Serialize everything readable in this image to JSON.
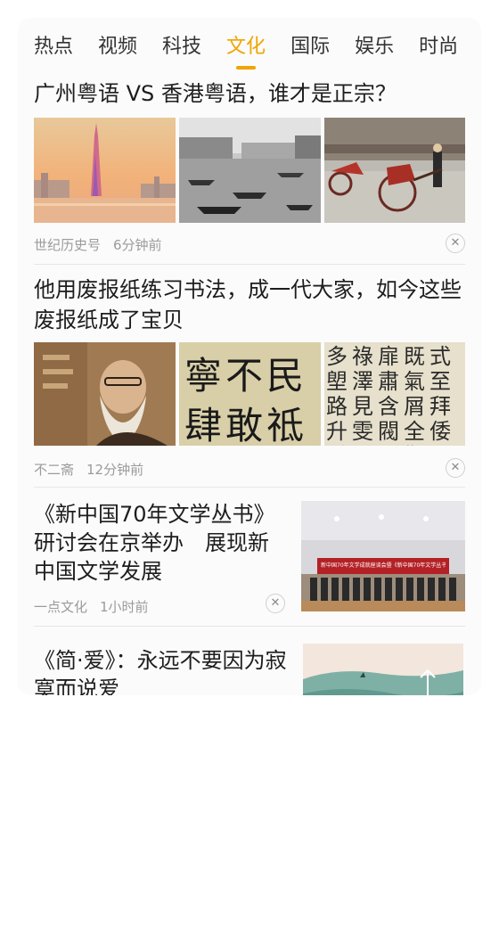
{
  "tabs": [
    {
      "label": "热点",
      "active": false
    },
    {
      "label": "视频",
      "active": false
    },
    {
      "label": "科技",
      "active": false
    },
    {
      "label": "文化",
      "active": true
    },
    {
      "label": "国际",
      "active": false
    },
    {
      "label": "娱乐",
      "active": false
    },
    {
      "label": "时尚",
      "active": false
    }
  ],
  "articles": [
    {
      "title_line1": "广州粤语 VS 香港粤语，谁才是正宗？",
      "source": "世纪历史号",
      "time": "6分钟前",
      "images": [
        "canton-tower-photo",
        "old-harbor-photo",
        "rickshaw-photo"
      ]
    },
    {
      "title_line1": "他用废报纸练习书法，成一代大家，如今这些",
      "title_line2": "废报纸成了宝贝",
      "source": "不二斋",
      "time": "12分钟前",
      "images": [
        "old-calligrapher-photo",
        "calligraphy-photo",
        "calligraphy-script-photo"
      ]
    },
    {
      "title_line1": "《新中国70年文学丛书》",
      "title_line2": "研讨会在京举办　展现新",
      "title_line3": "中国文学发展",
      "source": "一点文化",
      "time": "1小时前",
      "images": [
        "conference-photo"
      ],
      "banner": "新中国70年文学成就座谈会暨《新中国70年文学丛书》研讨会"
    },
    {
      "title_line1": "《简·爱》：永远不要因为寂",
      "title_line2": "寞而说爱",
      "images": [
        "landscape-painting"
      ]
    }
  ],
  "calligraphy": {
    "row1": "寧不民",
    "row2": "肆敢祗",
    "col_text": "多祿扉既式塱澤肅氣至路見含屑拜升雯閥全倭手堂跽觀"
  },
  "colors": {
    "accent": "#f0a500",
    "title": "#1d1d1d",
    "meta": "#9b9b9b"
  }
}
